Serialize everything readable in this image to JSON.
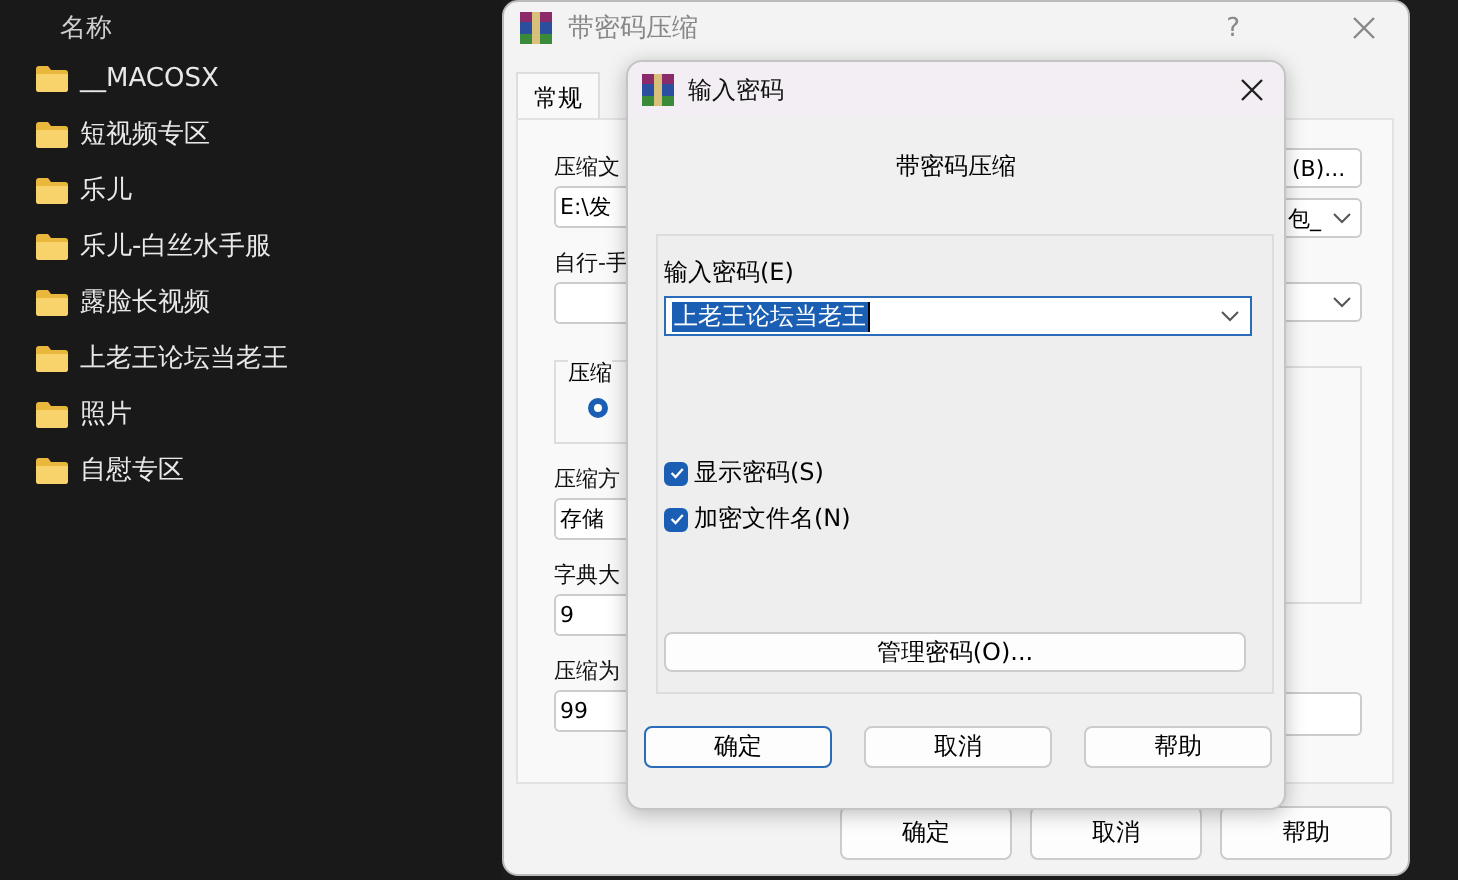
{
  "file_list": {
    "header": "名称",
    "folders": [
      {
        "name": "__MACOSX"
      },
      {
        "name": "短视频专区"
      },
      {
        "name": "乐儿"
      },
      {
        "name": "乐儿-白丝水手服"
      },
      {
        "name": "露脸长视频"
      },
      {
        "name": "上老王论坛当老王"
      },
      {
        "name": "照片"
      },
      {
        "name": "自慰专区"
      }
    ]
  },
  "back_dialog": {
    "title": "带密码压缩",
    "help": "?",
    "tabs": [
      {
        "label": "常规",
        "selected": true
      }
    ],
    "left": [
      {
        "kind": "label",
        "text": "压缩文"
      },
      {
        "kind": "field",
        "text": "E:\\发"
      },
      {
        "kind": "label",
        "text": "自行-手"
      },
      {
        "kind": "field"
      },
      {
        "kind": "group",
        "text": "压缩",
        "radio_checked": true
      },
      {
        "kind": "label",
        "text": "压缩方"
      },
      {
        "kind": "field",
        "text": "存储"
      },
      {
        "kind": "label",
        "text": "字典大"
      },
      {
        "kind": "field",
        "text": "9"
      },
      {
        "kind": "label",
        "text": "压缩为"
      },
      {
        "kind": "field",
        "text": "99"
      }
    ],
    "right": [
      {
        "kind": "button",
        "text": "(B)..."
      },
      {
        "kind": "dropdown",
        "text": "包_"
      },
      {
        "kind": "dropdown"
      },
      {
        "kind": "group"
      },
      {
        "kind": "field"
      }
    ],
    "buttons": [
      {
        "label": "确定"
      },
      {
        "label": "取消"
      },
      {
        "label": "帮助"
      }
    ]
  },
  "password_dialog": {
    "title": "输入密码",
    "header": "带密码压缩",
    "password_label": "输入密码(E)",
    "password_value": "上老王论坛当老王",
    "options": [
      {
        "label": "显示密码(S)",
        "checked": true
      },
      {
        "label": "加密文件名(N)",
        "checked": true
      }
    ],
    "manage_button": "管理密码(O)...",
    "buttons": [
      {
        "label": "确定",
        "focused": true
      },
      {
        "label": "取消",
        "focused": false
      },
      {
        "label": "帮助",
        "focused": false
      }
    ]
  }
}
